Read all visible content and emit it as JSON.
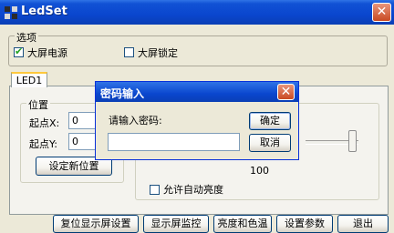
{
  "window": {
    "title": "LedSet",
    "close_glyph": "✕"
  },
  "options": {
    "group_label": "选项",
    "big_screen_power": {
      "label": "大屏电源",
      "checked": true
    },
    "big_screen_lock": {
      "label": "大屏锁定",
      "checked": false
    }
  },
  "tab": {
    "label": "LED1"
  },
  "position": {
    "group_label": "位置",
    "x_label": "起点X:",
    "x_value": "0",
    "y_label": "起点Y:",
    "y_value": "0",
    "set_button": "设定新位置"
  },
  "brightness": {
    "slider_value": "100",
    "auto_label": "允许自动亮度"
  },
  "bottom_buttons": [
    "复位显示屏设置",
    "显示屏监控",
    "亮度和色温",
    "设置参数",
    "退出"
  ],
  "dialog": {
    "title": "密码输入",
    "prompt": "请输入密码:",
    "password_value": "",
    "ok_label": "确定",
    "cancel_label": "取消",
    "close_glyph": "✕"
  }
}
